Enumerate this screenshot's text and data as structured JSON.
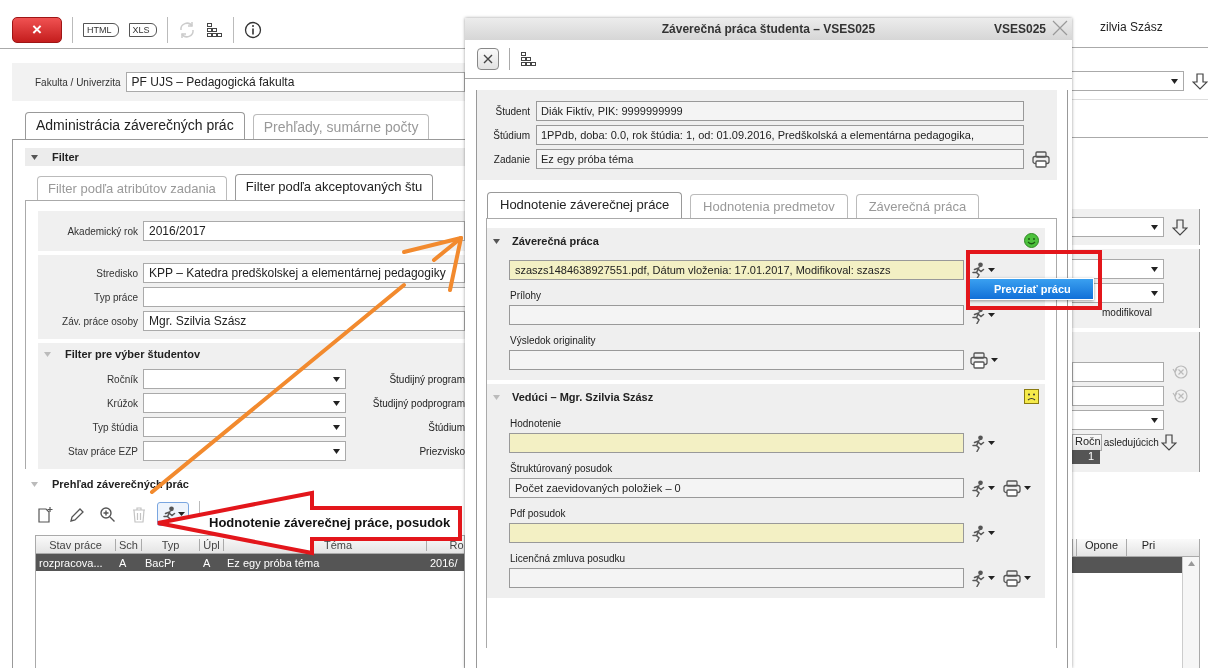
{
  "toolbar": {
    "close": "×",
    "exports": [
      "HTML",
      "XLS"
    ]
  },
  "faculty": {
    "label": "Fakulta / Univerzita",
    "value": "PF UJS – Pedagogická fakulta"
  },
  "tabs": [
    {
      "label": "Administrácia záverečných prác",
      "selected": true
    },
    {
      "label": "Prehľady, sumárne počty",
      "selected": false
    }
  ],
  "filter": {
    "title": "Filter",
    "tabs": [
      {
        "label": "Filter podľa atribútov zadania",
        "selected": false
      },
      {
        "label": "Filter podľa akceptovaných štu",
        "selected": true
      }
    ],
    "academic_year": {
      "label": "Akademický rok",
      "value": "2016/2017"
    },
    "fields": [
      {
        "label": "Stredisko",
        "value": "KPP – Katedra predškolskej a elementárnej pedagogiky"
      },
      {
        "label": "Typ práce"
      },
      {
        "label": "Záv. práce osoby",
        "value": "Mgr. Szilvia Szász"
      }
    ]
  },
  "student_filter": {
    "title": "Filter pre výber študentov",
    "rows": [
      {
        "label": "Ročník",
        "right_label": "Študijný program"
      },
      {
        "label": "Krúžok",
        "right_label": "Študijný podprogram"
      },
      {
        "label": "Typ štúdia",
        "right_label": "Štúdium"
      },
      {
        "label": "Stav práce EZP",
        "right_label": "Priezvisko"
      }
    ]
  },
  "overview": {
    "title": "Prehľad záverečných prác",
    "tools": [
      {
        "kind": "new",
        "disabled": false,
        "active": false
      },
      {
        "kind": "edit",
        "disabled": false,
        "active": false
      },
      {
        "kind": "zoom",
        "disabled": false,
        "active": false
      },
      {
        "kind": "delete",
        "disabled": true,
        "active": false
      },
      {
        "kind": "evaluate",
        "disabled": false,
        "active": true
      }
    ],
    "table": {
      "columns": [
        "Stav práce",
        "Sch",
        "Typ",
        "Úpl",
        "Téma",
        "Ro"
      ],
      "rows": [
        {
          "cells": [
            "rozpracova...",
            "A",
            "BacPr",
            "A",
            "Ez egy próba téma",
            "2016/"
          ],
          "selected": true
        }
      ]
    }
  },
  "callout": "Hodnotenie záverečnej práce, posudok",
  "right_pane": {
    "user": "zilvia Szász",
    "note": "modifikoval",
    "column_header": "Ročn",
    "link": "asledujúcich",
    "count": "1",
    "table_columns": [
      "Opone",
      "Pri"
    ]
  },
  "dialog": {
    "title": "Záverečná práca študenta – VSES025",
    "code": "VSES025",
    "info": [
      {
        "label": "Študent",
        "value": "Diák Fiktív, PIK: 9999999999",
        "printable": false
      },
      {
        "label": "Štúdium",
        "value": "1PPdb, doba: 0.0, rok štúdia: 1, od: 01.09.2016, Predškolská a elementárna pedagogika,",
        "printable": false
      },
      {
        "label": "Zadanie",
        "value": "Ez egy próba téma",
        "printable": true
      }
    ],
    "tabs": [
      {
        "label": "Hodnotenie záverečnej práce",
        "selected": true
      },
      {
        "label": "Hodnotenia predmetov",
        "selected": false
      },
      {
        "label": "Záverečná práca",
        "selected": false
      }
    ],
    "sections": [
      {
        "title": "Záverečná práca",
        "satisfied": true,
        "fields": [
          {
            "value": "szaszs1484638927551.pdf, Dátum vloženia: 17.01.2017, Modifikoval: szaszs",
            "highlighted": true,
            "runnable": true,
            "printable": false,
            "menu": [
              "Prevziať prácu"
            ]
          },
          {
            "label": "Prílohy",
            "highlighted": false,
            "runnable": true,
            "printable": false
          },
          {
            "label": "Výsledok originality",
            "highlighted": false,
            "runnable": false,
            "printable": true
          }
        ]
      },
      {
        "title": "Vedúci – Mgr. Szilvia Szász",
        "satisfied": false,
        "fields": [
          {
            "label": "Hodnotenie",
            "highlighted": true,
            "runnable": true,
            "printable": false
          },
          {
            "label": "Štruktúrovaný posudok",
            "value": "Počet zaevidovaných položiek – 0",
            "highlighted": false,
            "runnable": true,
            "printable": true
          },
          {
            "label": "Pdf posudok",
            "highlighted": true,
            "runnable": true,
            "printable": false
          },
          {
            "label": "Licenčná zmluva posudku",
            "highlighted": false,
            "runnable": true,
            "printable": true
          }
        ]
      }
    ]
  }
}
